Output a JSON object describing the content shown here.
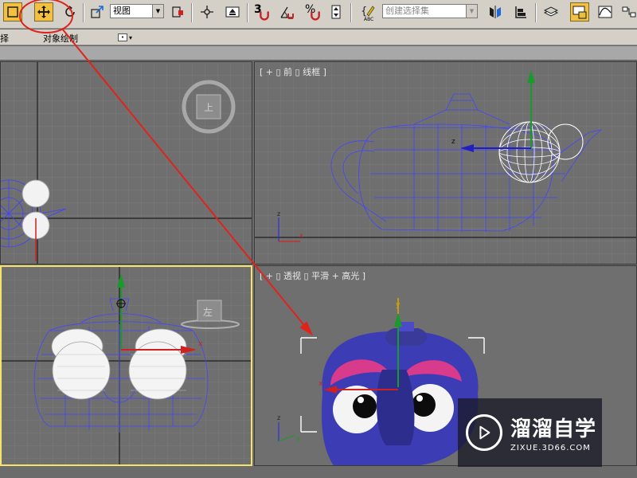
{
  "toolbar": {
    "view_select": "视图",
    "number_3": "3",
    "selection_set_placeholder": "创建选择集",
    "abc_label": "ABC",
    "percent_label": "%"
  },
  "ribbon": {
    "left_label": "择",
    "object_paint_label": "对象绘制"
  },
  "viewports": {
    "front": {
      "label": "[ + ▯ 前 ▯ 线框 ]"
    },
    "perspective": {
      "label": "[ + ▯ 透视 ▯ 平滑 + 高光 ]"
    },
    "left": {
      "cube_label": "左"
    },
    "top": {
      "cube_label": "上"
    }
  },
  "gizmo": {
    "x": "x",
    "y": "y",
    "z": "z"
  },
  "watermark": {
    "brand": "溜溜自学",
    "url": "ZIXUE.3D66.COM"
  },
  "colors": {
    "active_border": "#f7e36a",
    "annotation_red": "#e0231b",
    "wire_blue": "#3d3df2",
    "viewport_bg": "#6f6f6f"
  }
}
